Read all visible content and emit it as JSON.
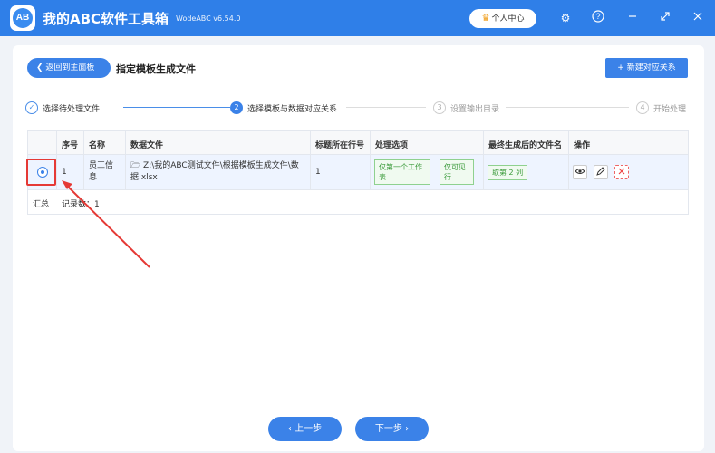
{
  "app": {
    "logo_text": "AB",
    "title": "我的ABC软件工具箱",
    "version": "WodeABC v6.54.0",
    "user_center": "个人中心"
  },
  "toolbar": {
    "back_label": "返回到主面板",
    "page_title": "指定模板生成文件",
    "new_mapping_label": "新建对应关系"
  },
  "steps": [
    {
      "num": "✓",
      "label": "选择待处理文件"
    },
    {
      "num": "2",
      "label": "选择模板与数据对应关系"
    },
    {
      "num": "3",
      "label": "设置输出目录"
    },
    {
      "num": "4",
      "label": "开始处理"
    }
  ],
  "table": {
    "headers": [
      "序号",
      "名称",
      "数据文件",
      "标题所在行号",
      "处理选项",
      "最终生成后的文件名",
      "操作"
    ],
    "rows": [
      {
        "index": "1",
        "name_line1": "员工信",
        "name_line2": "息",
        "file_line1": "Z:\\我的ABC测试文件\\根据模板生成文件\\数",
        "file_line2": "据.xlsx",
        "header_row": "1",
        "option1_line1": "仅第一个工作",
        "option1_line2": "表",
        "option2_line1": "仅可见",
        "option2_line2": "行",
        "output_name": "取第 2 列"
      }
    ],
    "summary_label": "汇总",
    "summary_count": "记录数：1"
  },
  "footer": {
    "prev_label": "上一步",
    "next_label": "下一步"
  },
  "colors": {
    "primary": "#3b82e8",
    "titlebar": "#2f7fe8",
    "highlight": "#e53935",
    "tag_green": "#3a9a3a"
  }
}
